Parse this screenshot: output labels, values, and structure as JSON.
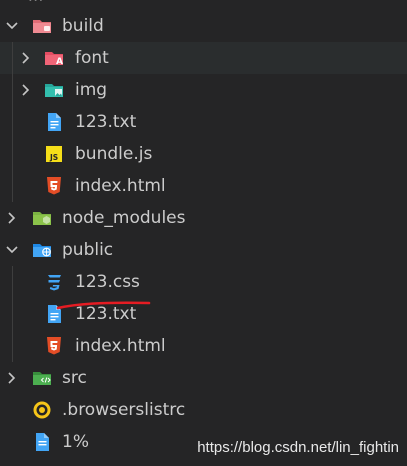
{
  "explorer": {
    "tree": [
      {
        "id": "build",
        "label": "build",
        "kind": "folder",
        "icon": "folder-build-icon",
        "expanded": true
      },
      {
        "id": "font",
        "label": "font",
        "kind": "folder",
        "icon": "folder-font-icon",
        "expanded": false
      },
      {
        "id": "img",
        "label": "img",
        "kind": "folder",
        "icon": "folder-images-icon",
        "expanded": false
      },
      {
        "id": "build_123txt",
        "label": "123.txt",
        "kind": "file",
        "icon": "text-file-icon"
      },
      {
        "id": "bundle_js",
        "label": "bundle.js",
        "kind": "file",
        "icon": "javascript-file-icon"
      },
      {
        "id": "build_index_html",
        "label": "index.html",
        "kind": "file",
        "icon": "html5-file-icon"
      },
      {
        "id": "node_modules",
        "label": "node_modules",
        "kind": "folder",
        "icon": "folder-node-icon",
        "expanded": false
      },
      {
        "id": "public",
        "label": "public",
        "kind": "folder",
        "icon": "folder-public-icon",
        "expanded": true
      },
      {
        "id": "public_123css",
        "label": "123.css",
        "kind": "file",
        "icon": "css3-file-icon"
      },
      {
        "id": "public_123txt",
        "label": "123.txt",
        "kind": "file",
        "icon": "text-file-icon"
      },
      {
        "id": "public_index_html",
        "label": "index.html",
        "kind": "file",
        "icon": "html5-file-icon"
      },
      {
        "id": "src",
        "label": "src",
        "kind": "folder",
        "icon": "folder-src-icon",
        "expanded": false
      },
      {
        "id": "browserslistrc",
        "label": ".browserslistrc",
        "kind": "file",
        "icon": "browserslist-icon"
      },
      {
        "id": "one_percent",
        "label": "1%",
        "kind": "file",
        "icon": "generic-file-icon"
      }
    ]
  },
  "watermark": "https://blog.csdn.net/lin_fightin",
  "colors": {
    "background": "#252526",
    "text": "#cccccc",
    "folder_build": "#e06c75",
    "folder_font": "#e44d62",
    "folder_img": "#26a69a",
    "folder_node": "#8bc34a",
    "folder_public": "#42a5f5",
    "folder_src": "#4caf50",
    "txt": "#42a5f5",
    "js": "#f5de19",
    "html": "#e44d26",
    "css": "#42a5f5",
    "annotation": "#e51c23"
  }
}
